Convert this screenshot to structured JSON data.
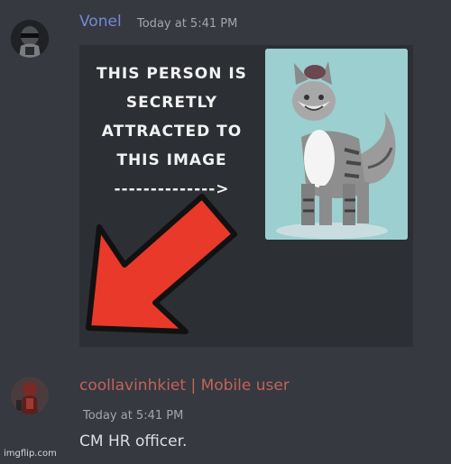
{
  "messages": [
    {
      "username": "Vonel",
      "timestamp": "Today at 5:41 PM",
      "username_color": "#7289da",
      "avatar": "masked-character-avatar",
      "attachment": {
        "caption_lines": [
          "THIS PERSON IS",
          "SECRETLY",
          "ATTRACTED TO",
          "THIS IMAGE",
          "-------------->"
        ],
        "art": "grey-cat-creature-drawing",
        "arrow_color": "#e8392a"
      }
    },
    {
      "username": "coollavinhkiet | Mobile user",
      "timestamp": "Today at 5:41 PM",
      "username_color": "#c2625a",
      "avatar": "dark-red-character-avatar",
      "text": "CM HR officer."
    }
  ],
  "watermark": "imgflip.com",
  "colors": {
    "background": "#36393f",
    "text": "#dcddde",
    "timestamp": "#a3a6aa"
  }
}
